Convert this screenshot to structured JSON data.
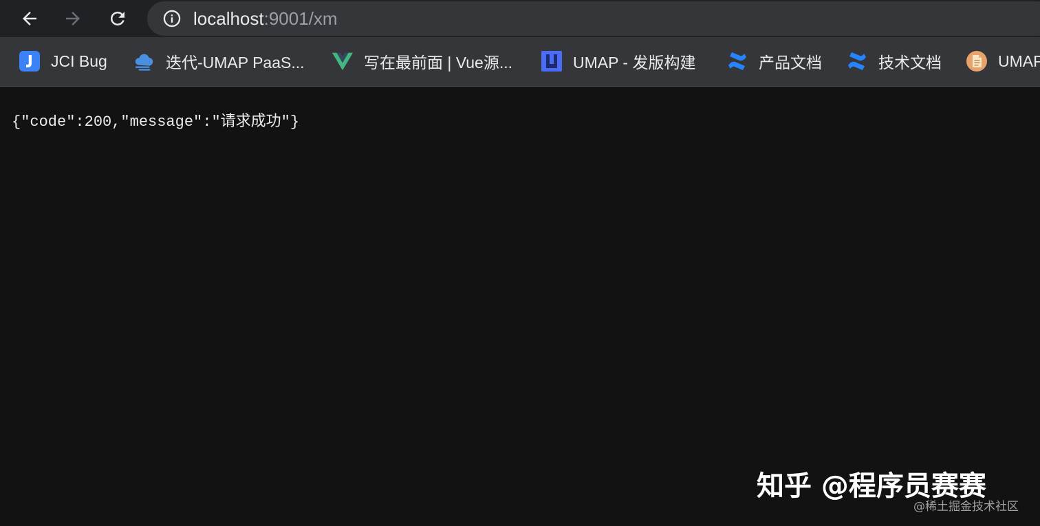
{
  "toolbar": {
    "url_host": "localhost",
    "url_rest": ":9001/xm"
  },
  "bookmarks": [
    {
      "label": "JCI Bug",
      "icon": "j-badge-icon",
      "color": "#3b82f6"
    },
    {
      "label": "迭代-UMAP PaaS...",
      "icon": "cloud-icon",
      "color": "#4a90e2"
    },
    {
      "label": "写在最前面 | Vue源...",
      "icon": "vue-logo-icon",
      "color": "#41b883"
    },
    {
      "label": "UMAP - 发版构建",
      "icon": "u-logo-icon",
      "color": "#4a6cf7"
    },
    {
      "label": "产品文档",
      "icon": "confluence-icon",
      "color": "#2684ff"
    },
    {
      "label": "技术文档",
      "icon": "confluence-icon",
      "color": "#2684ff"
    },
    {
      "label": "UMAP",
      "icon": "document-icon",
      "color": "#e8a36b"
    }
  ],
  "content": {
    "json_text": "{\"code\":200,\"message\":\"请求成功\"}"
  },
  "watermark": {
    "main": "知乎 @程序员赛赛",
    "sub": "@稀土掘金技术社区"
  }
}
